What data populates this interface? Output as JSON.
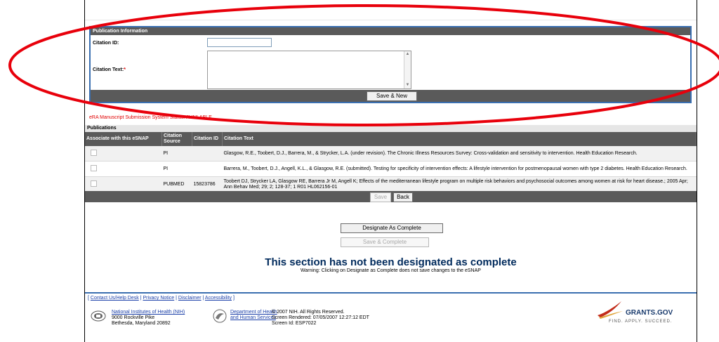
{
  "pub_info": {
    "header": "Publication Information",
    "citation_id_label": "Citation ID:",
    "citation_id_value": "",
    "citation_text_label": "Citation Text:",
    "required_mark": "*",
    "save_new_label": "Save & New"
  },
  "status_text": "eRA Manuscript Submission System Status: AVAILABLE",
  "publications": {
    "header": "Publications",
    "columns": [
      "Associate with this eSNAP",
      "Citation Source",
      "Citation ID",
      "Citation Text"
    ],
    "rows": [
      {
        "source": "PI",
        "id": "",
        "text": "Glasgow, R.E., Toobert, D.J., Barrera, M., & Strycker, L.A. (under revision). The Chronic Illness Resources Survey: Cross-validation and sensitivity to intervention. Health Education Research."
      },
      {
        "source": "PI",
        "id": "",
        "text": "Barrera, M., Toobert, D.J., Angell, K.L., & Glasgow, R.E. (submitted). Testing for specificity of intervention effects: A lifestyle intervention for postmenopausal women with type 2 diabetes. Health Education Research."
      },
      {
        "source": "PUBMED",
        "id": "15823786",
        "text": "Toobert DJ, Strycker LA, Glasgow RE, Barrera Jr M, Angell K; Effects of the mediterranean lifestyle program on multiple risk behaviors and psychosocial outcomes among women at risk for heart disease.; 2005 Apr; Ann Behav Med; 29; 2; 128-37; 1 R01 HL062156-01"
      }
    ],
    "save_label": "Save",
    "back_label": "Back"
  },
  "designate": {
    "designate_label": "Designate As Complete",
    "save_complete_label": "Save & Complete",
    "message": "This section has not been designated as complete",
    "warning": "Warning: Clicking on Designate as Complete does not save changes to the eSNAP"
  },
  "footer": {
    "links": [
      "Contact Us/Help Desk",
      "Privacy Notice",
      "Disclaimer",
      "Accessibility"
    ],
    "nih_name": "National Institutes of Health (NIH)",
    "nih_addr1": "9000 Rockville Pike",
    "nih_addr2": "Bethesda, Maryland 20892",
    "hhs_line1": "Department of Health",
    "hhs_line2": "and Human Services",
    "copyright": "© 2007 NIH. All Rights Reserved.",
    "rendered": "Screen Rendered: 07/05/2007 12:27:12 EDT",
    "screen_id": "Screen Id: ESP7022",
    "grants_logo": "GRANTS.GOV",
    "grants_tagline": "FIND. APPLY. SUCCEED."
  },
  "colors": {
    "annotation": "#e8000b",
    "header_bar": "#5a5a5a",
    "accent_blue": "#3a6fb0"
  }
}
